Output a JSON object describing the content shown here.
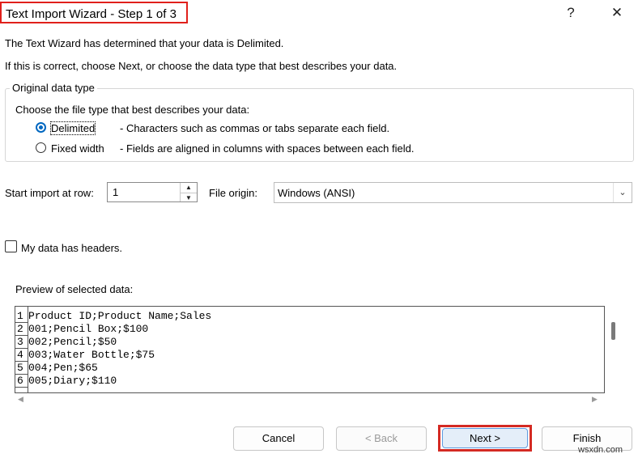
{
  "window": {
    "title": "Text Import Wizard - Step 1 of 3",
    "help_glyph": "?",
    "close_glyph": "✕"
  },
  "intro": {
    "line1": "The Text Wizard has determined that your data is Delimited.",
    "line2": "If this is correct, choose Next, or choose the data type that best describes your data."
  },
  "original_data_type": {
    "group_label": "Original data type",
    "prompt": "Choose the file type that best describes your data:",
    "options": [
      {
        "label": "Delimited",
        "description": "- Characters such as commas or tabs separate each field.",
        "selected": true
      },
      {
        "label": "Fixed width",
        "description": "- Fields are aligned in columns with spaces between each field.",
        "selected": false
      }
    ]
  },
  "start_row": {
    "label": "Start import at row:",
    "value": "1"
  },
  "file_origin": {
    "label": "File origin:",
    "value": "Windows (ANSI)"
  },
  "headers_checkbox": {
    "label": "My data has headers.",
    "checked": false
  },
  "preview": {
    "label": "Preview of selected data:",
    "rows": [
      {
        "num": "1",
        "text": "Product ID;Product Name;Sales"
      },
      {
        "num": "2",
        "text": "001;Pencil Box;$100"
      },
      {
        "num": "3",
        "text": "002;Pencil;$50"
      },
      {
        "num": "4",
        "text": "003;Water Bottle;$75"
      },
      {
        "num": "5",
        "text": "004;Pen;$65"
      },
      {
        "num": "6",
        "text": "005;Diary;$110"
      }
    ]
  },
  "buttons": {
    "cancel": "Cancel",
    "back": "< Back",
    "next": "Next >",
    "finish": "Finish"
  },
  "watermark": "wsxdn.com",
  "colors": {
    "highlight_red": "#d42a23",
    "accent_blue": "#0067c0"
  }
}
